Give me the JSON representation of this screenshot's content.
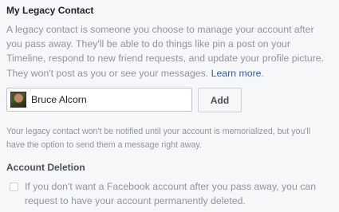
{
  "legacy_contact": {
    "title": "My Legacy Contact",
    "description": "A legacy contact is someone you choose to manage your account after you pass away. They'll be able to do things like pin a post on your Timeline, respond to new friend requests, and update your profile picture. They won't post as you or see your messages.",
    "learn_more_label": "Learn more",
    "description_end": ".",
    "contact_name": "Bruce Alcorn",
    "add_button_label": "Add",
    "notice": "Your legacy contact won't be notified until your account is memorialized, but you'll have the option to send them a message right away."
  },
  "account_deletion": {
    "title": "Account Deletion",
    "checked": false,
    "option_text": "If you don't want a Facebook account after you pass away, you can request to have your account permanently deleted."
  },
  "colors": {
    "background": "#f6f7f9",
    "link": "#365899",
    "muted_text": "#90949c",
    "heading_text": "#1d2129"
  },
  "icons": {
    "contact_avatar": "profile-photo"
  }
}
